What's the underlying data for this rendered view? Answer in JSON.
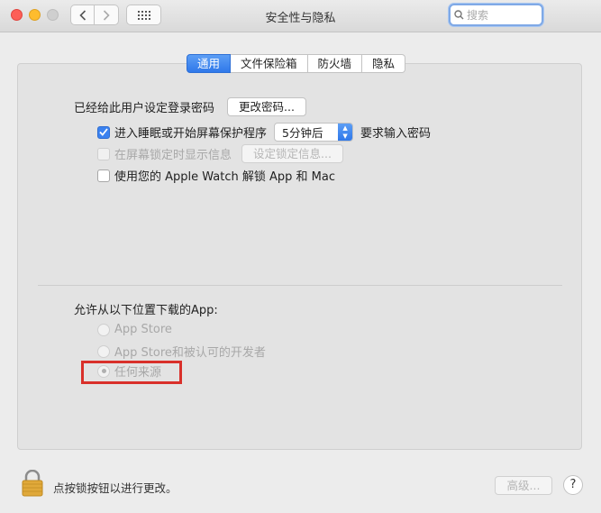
{
  "window": {
    "title": "安全性与隐私",
    "search_placeholder": "搜索"
  },
  "tabs": [
    {
      "label": "通用",
      "active": true
    },
    {
      "label": "文件保险箱",
      "active": false
    },
    {
      "label": "防火墙",
      "active": false
    },
    {
      "label": "隐私",
      "active": false
    }
  ],
  "general": {
    "password_label": "已经给此用户设定登录密码",
    "change_password_button": "更改密码...",
    "require_password": {
      "checked": true,
      "label": "进入睡眠或开始屏幕保护程序",
      "delay_value": "5分钟后",
      "suffix": "要求输入密码"
    },
    "show_message": {
      "checked": false,
      "disabled": true,
      "label": "在屏幕锁定时显示信息",
      "button": "设定锁定信息..."
    },
    "apple_watch": {
      "checked": false,
      "label": "使用您的 Apple Watch 解锁 App 和 Mac"
    }
  },
  "downloads": {
    "heading": "允许从以下位置下载的App:",
    "options": [
      {
        "label": "App Store",
        "selected": false
      },
      {
        "label": "App Store和被认可的开发者",
        "selected": false
      },
      {
        "label": "任何来源",
        "selected": true
      }
    ],
    "highlight_color": "#d9302a"
  },
  "footer": {
    "lock_text": "点按锁按钮以进行更改。",
    "advanced_button": "高级...",
    "help_button": "?"
  },
  "colors": {
    "accent": "#2f78ea"
  }
}
